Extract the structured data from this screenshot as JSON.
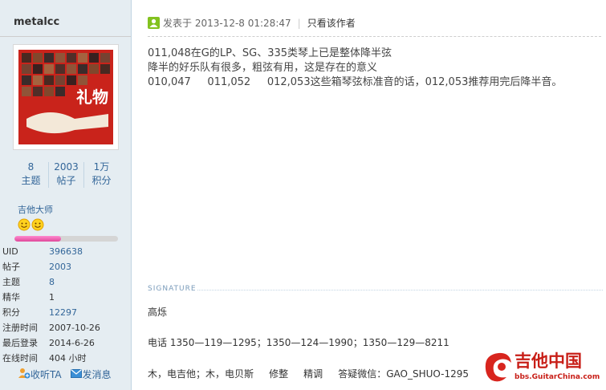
{
  "profile": {
    "username": "metalcc",
    "avatar_text": "礼物",
    "stats": [
      {
        "value": "8",
        "label": "主题"
      },
      {
        "value": "2003",
        "label": "帖子"
      },
      {
        "value": "1万",
        "label": "积分"
      }
    ],
    "rank": "吉他大师",
    "rank_progress": 0.45,
    "info": [
      {
        "key": "UID",
        "value": "396638",
        "link": true
      },
      {
        "key": "帖子",
        "value": "2003",
        "link": true
      },
      {
        "key": "主题",
        "value": "8",
        "link": true
      },
      {
        "key": "精华",
        "value": "1",
        "link": false
      },
      {
        "key": "积分",
        "value": "12297",
        "link": true
      },
      {
        "key": "注册时间",
        "value": "2007-10-26",
        "link": false
      },
      {
        "key": "最后登录",
        "value": "2014-6-26",
        "link": false
      },
      {
        "key": "在线时间",
        "value": "404 小时",
        "link": false
      }
    ],
    "actions": {
      "follow": "收听TA",
      "message": "发消息"
    }
  },
  "post": {
    "posted_label": "发表于 2013-12-8 01:28:47",
    "only_author": "只看该作者",
    "lines": [
      "011,048在G的LP、SG、335类琴上已是整体降半弦",
      "降半的好乐队有很多，粗弦有用，这是存在的意义",
      "010,047     011,052     012,053这些箱琴弦标准音的话，012,053推荐用完后降半音。"
    ]
  },
  "signature": {
    "label": "SIGNATURE",
    "lines": [
      "高烁",
      "电话 1350—119—1295；1350—124—1990；1350—129—8211",
      "木，电吉他；木，电贝斯     修整     精调     答疑微信：GAO_SHUO-1295"
    ]
  },
  "logo": {
    "cn": "吉他中国",
    "en": "bbs.GuitarChina.com"
  }
}
